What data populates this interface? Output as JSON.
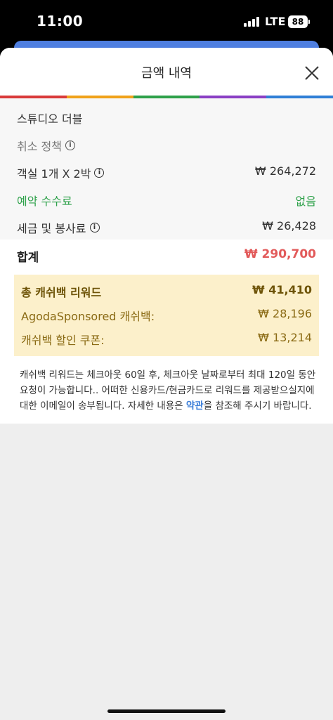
{
  "status": {
    "time": "11:00",
    "network": "LTE",
    "battery": "88"
  },
  "header": {
    "title": "금액 내역"
  },
  "rainbow_colors": [
    "#d93a3a",
    "#f0a21a",
    "#2ea14a",
    "#8a3fc4",
    "#2f7fd6"
  ],
  "breakdown": {
    "room_name": "스튜디오 더블",
    "cancel_policy": "취소 정책",
    "room_label": "객실 1개 X 2박",
    "room_price": "₩ 264,272",
    "booking_fee_label": "예약 수수료",
    "booking_fee_value": "없음",
    "tax_label": "세금 및 봉사료",
    "tax_value": "₩ 26,428"
  },
  "total": {
    "label": "합계",
    "value": "₩ 290,700"
  },
  "cashback": {
    "total_label": "총 캐쉬백 리워드",
    "total_value": "₩ 41,410",
    "sponsored_label": "AgodaSponsored 캐쉬백:",
    "sponsored_value": "₩ 28,196",
    "coupon_label": "캐쉬백 할인 쿠폰:",
    "coupon_value": "₩ 13,214"
  },
  "note": {
    "before_link": "캐쉬백 리워드는 체크아웃 60일 후, 체크아웃 날짜로부터 최대 120일 동안 요청이 가능합니다.. 어떠한 신용카드/현금카드로 리워드를 제공받으실지에 대한 이메일이 송부됩니다. 자세한 내용은 ",
    "link": "약관",
    "after_link": "을 참조해 주시기 바랍니다."
  }
}
